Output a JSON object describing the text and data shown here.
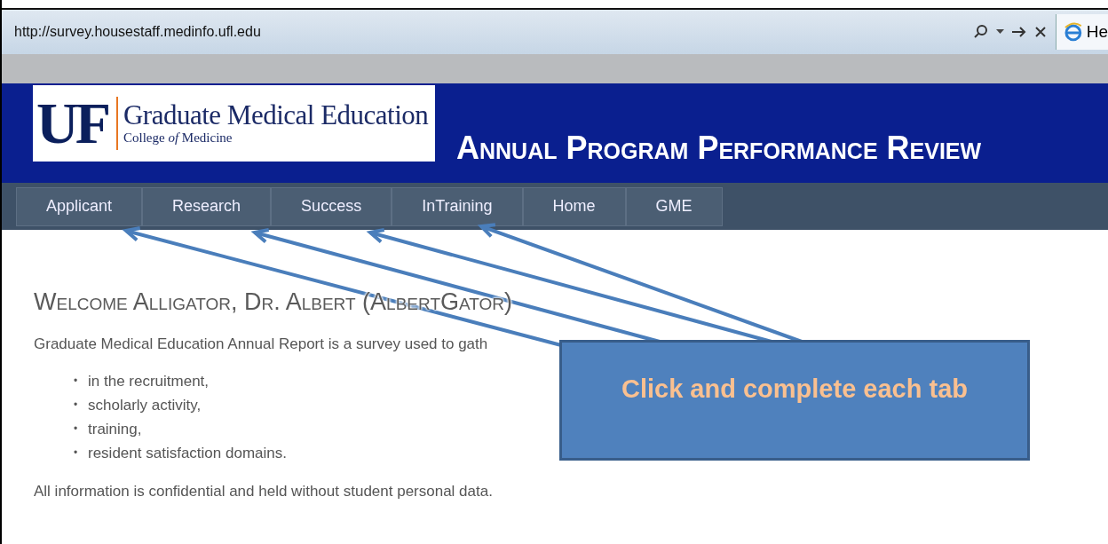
{
  "browser": {
    "address": "http://survey.housestaff.medinfo.ufl.edu",
    "tab_title": "He"
  },
  "header": {
    "logo_mark": "UF",
    "logo_title": "Graduate Medical Education",
    "logo_subtitle": "College *of* Medicine",
    "title": "Annual Program Performance Review"
  },
  "nav": [
    {
      "label": "Applicant"
    },
    {
      "label": "Research"
    },
    {
      "label": "Success"
    },
    {
      "label": "InTraining"
    },
    {
      "label": "Home"
    },
    {
      "label": "GME"
    }
  ],
  "content": {
    "heading": "Welcome Alligator, Dr. Albert (AlbertGator)",
    "intro": "Graduate Medical Education Annual Report is a survey used to gath",
    "bullets": [
      {
        "marker": "•",
        "text": "in the recruitment,"
      },
      {
        "marker": "•",
        "text": "scholarly activity,"
      },
      {
        "marker": "•",
        "text": "training,"
      },
      {
        "marker": "•",
        "text": "resident satisfaction domains."
      }
    ],
    "note": "All information is confidential and held without student personal data."
  },
  "callout": {
    "text": "Click and complete each tab"
  }
}
